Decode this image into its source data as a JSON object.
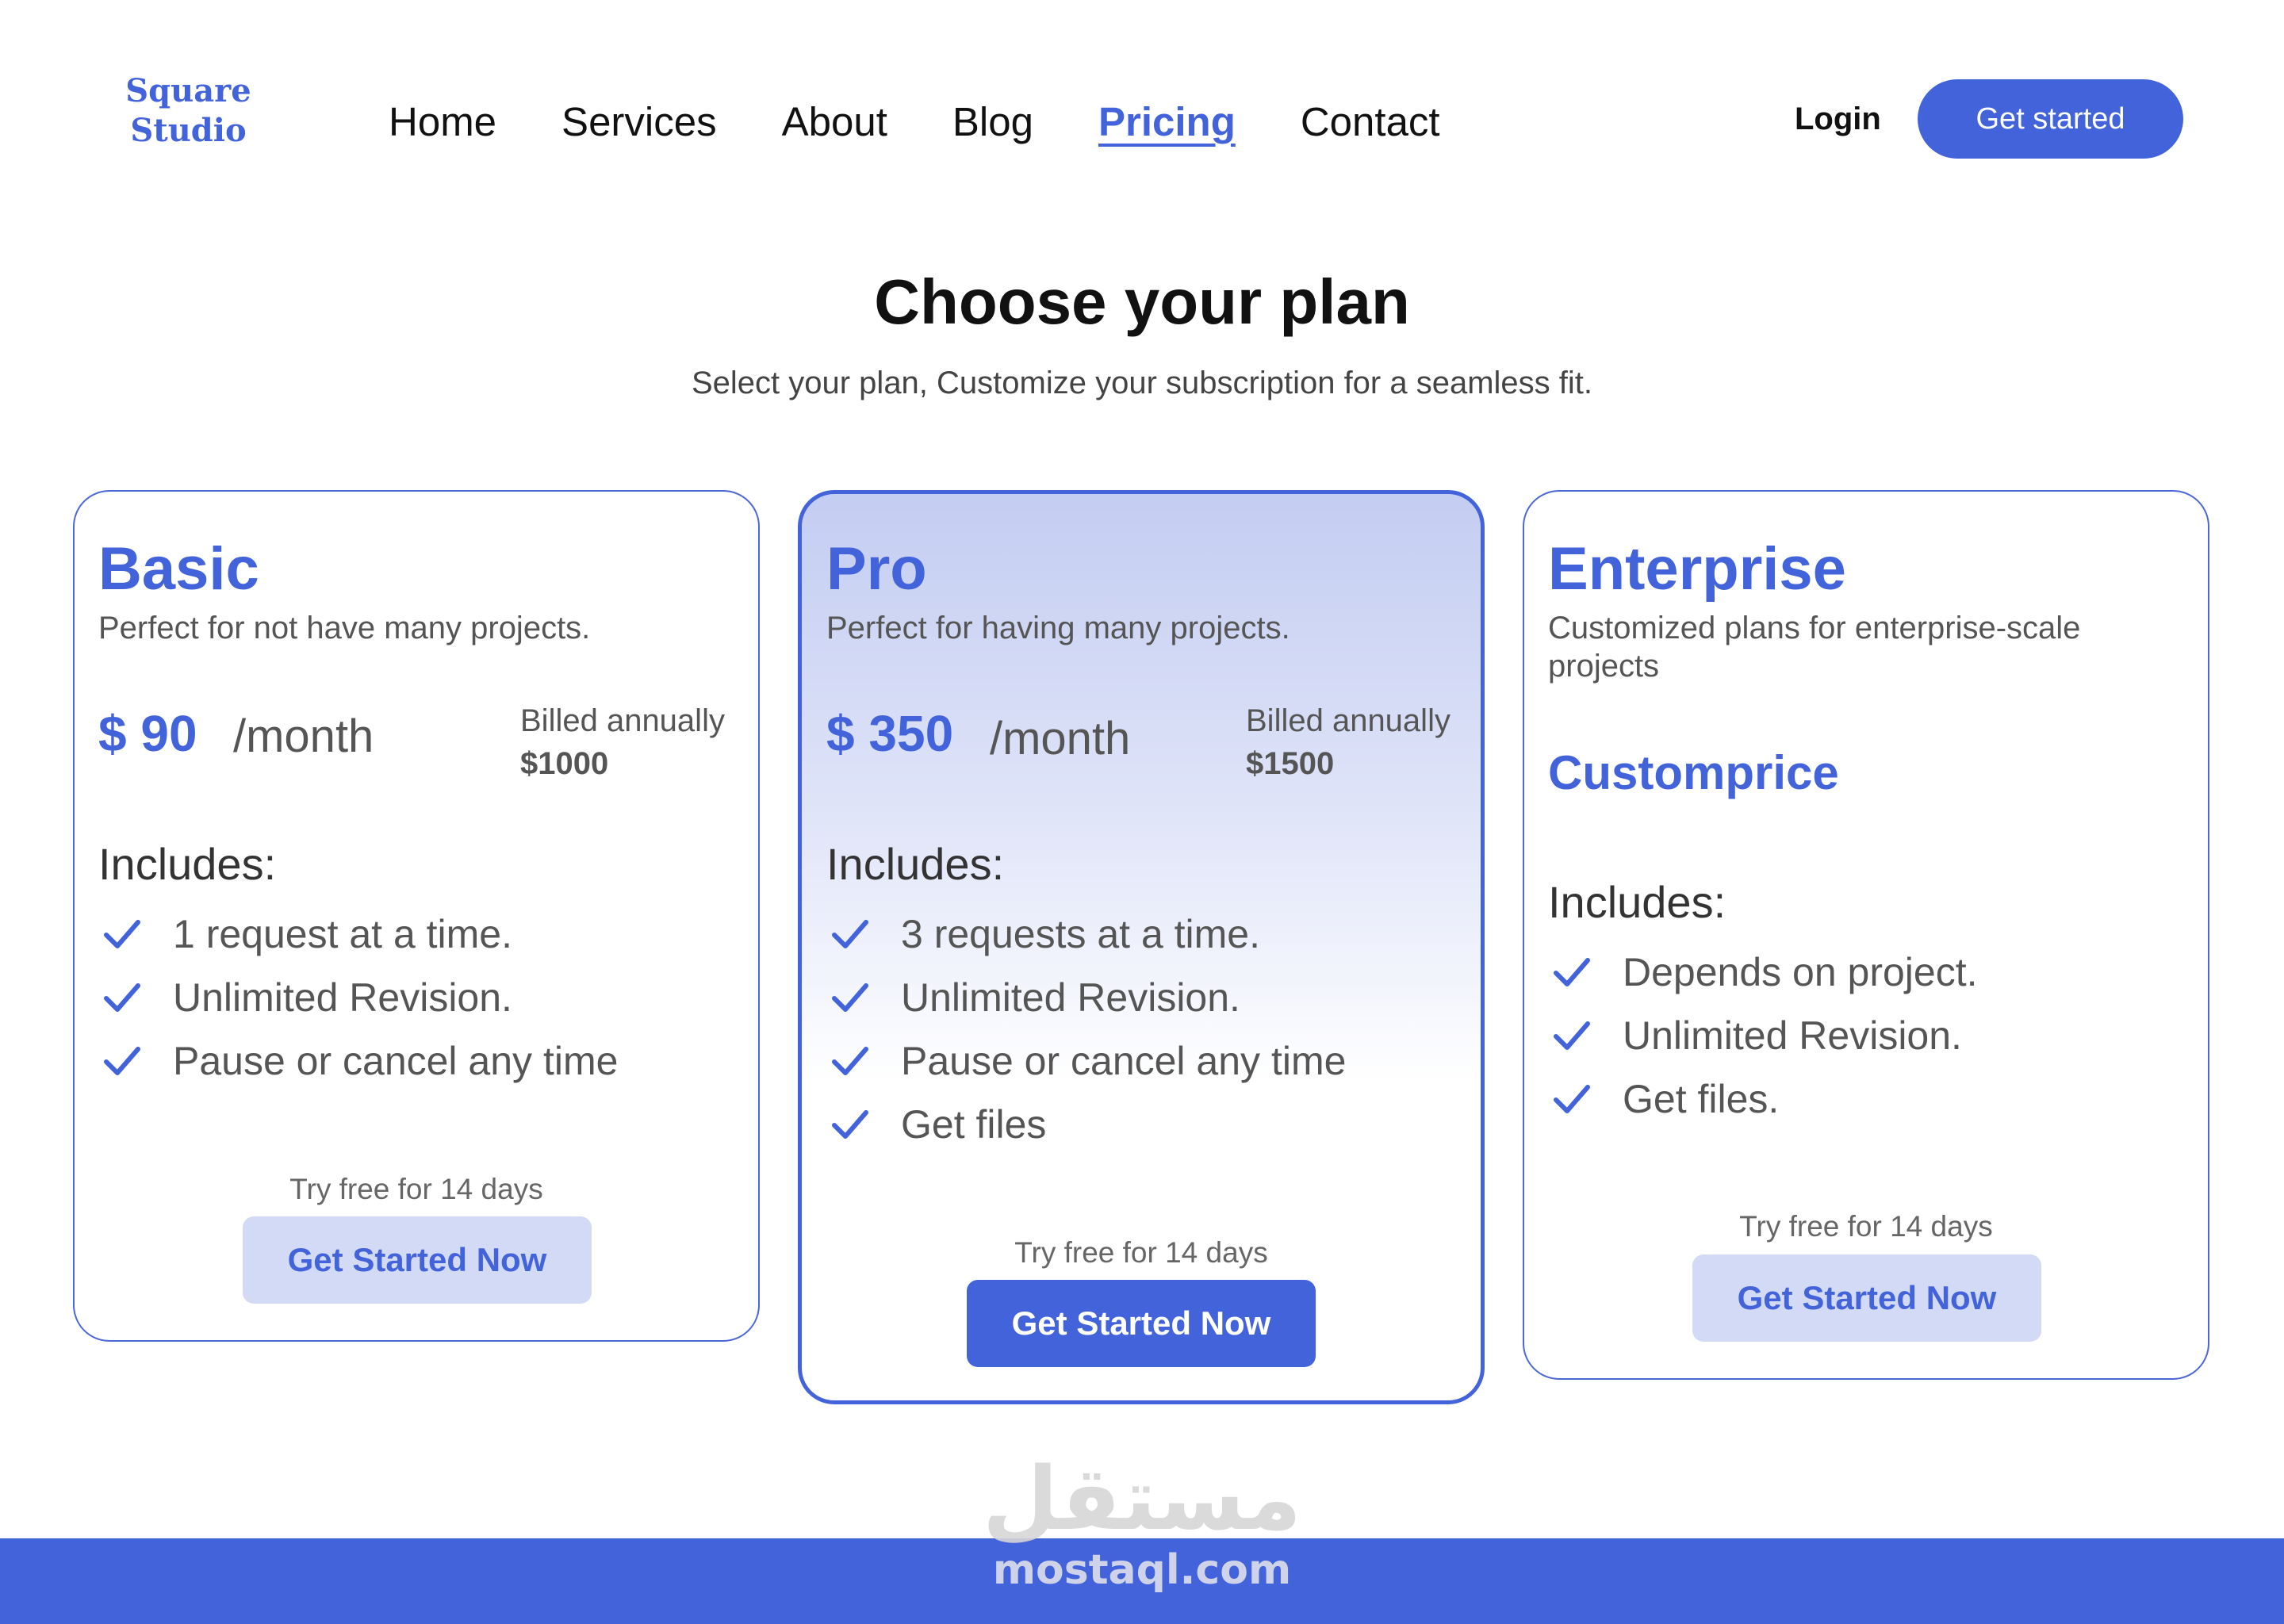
{
  "brand": {
    "line1": "Square",
    "line2": "Studio",
    "color": "#4363db"
  },
  "nav": {
    "items": [
      {
        "label": "Home",
        "active": false
      },
      {
        "label": "Services",
        "active": false
      },
      {
        "label": "About",
        "active": false
      },
      {
        "label": "Blog",
        "active": false
      },
      {
        "label": "Pricing",
        "active": true
      },
      {
        "label": "Contact",
        "active": false
      }
    ],
    "login_label": "Login",
    "cta_label": "Get started"
  },
  "hero": {
    "title": "Choose your plan",
    "subtitle": "Select your plan, Customize your subscription for a seamless fit."
  },
  "plans": [
    {
      "name": "Basic",
      "description": "Perfect for not have many projects.",
      "price": "$ 90",
      "period": "/month",
      "billed_label": "Billed annually",
      "billed_amount": "$1000",
      "includes_label": "Includes:",
      "features": [
        "1 request at a time.",
        "Unlimited Revision.",
        "Pause or cancel any time"
      ],
      "trial_text": "Try free for 14 days",
      "cta_label": "Get Started Now",
      "featured": false
    },
    {
      "name": "Pro",
      "description": "Perfect for having many projects.",
      "price": "$ 350",
      "period": "/month",
      "billed_label": "Billed annually",
      "billed_amount": "$1500",
      "includes_label": "Includes:",
      "features": [
        "3 requests at a time.",
        "Unlimited Revision.",
        "Pause or cancel any time",
        "Get files"
      ],
      "trial_text": "Try free for 14 days",
      "cta_label": "Get Started Now",
      "featured": true
    },
    {
      "name": "Enterprise",
      "description": "Customized plans for enterprise-scale projects",
      "custom_price": "Customprice",
      "includes_label": "Includes:",
      "features": [
        "Depends on project.",
        "Unlimited Revision.",
        "Get files."
      ],
      "trial_text": "Try free for 14 days",
      "cta_label": "Get Started Now",
      "featured": false
    }
  ],
  "watermark": {
    "arabic": "مستقل",
    "latin": "mostaql.com"
  },
  "colors": {
    "accent": "#4363db",
    "accent_light": "#d3daf6",
    "footer": "#4363db"
  },
  "icons": {
    "feature_check": "check-icon"
  }
}
